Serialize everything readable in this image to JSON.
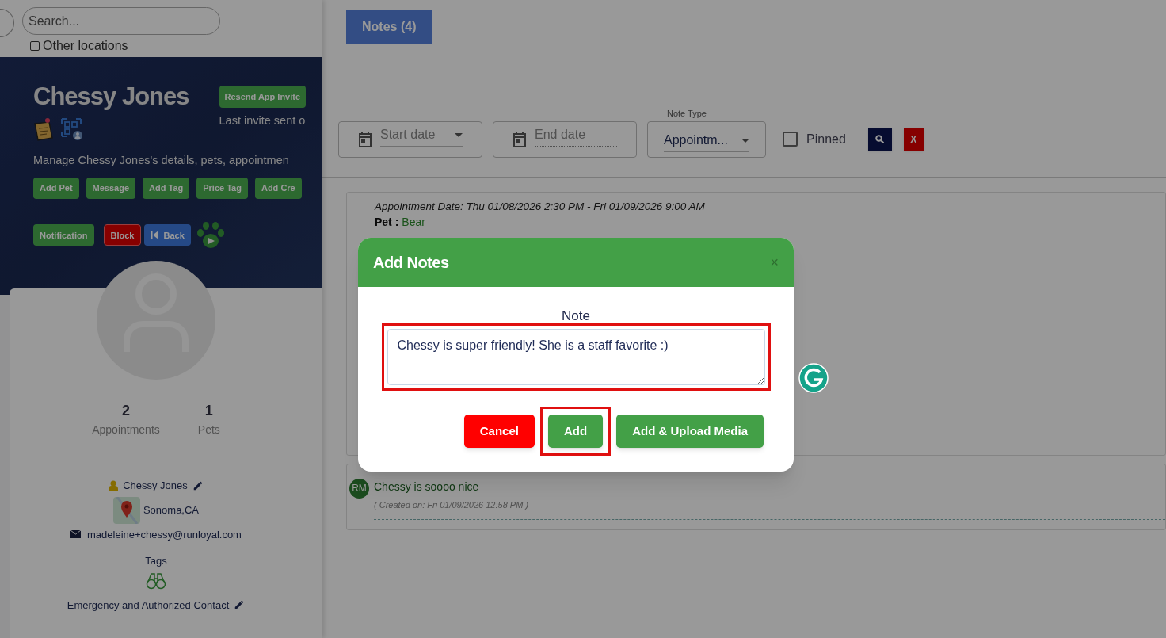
{
  "search": {
    "placeholder": "Search..."
  },
  "other_locations": {
    "label": "Other locations",
    "checked": false
  },
  "profile": {
    "name": "Chessy Jones",
    "resend_button": "Resend App Invite",
    "last_invite": "Last invite sent o",
    "description": "Manage Chessy Jones's details, pets, appointmen",
    "actions": [
      {
        "label": "Add Pet",
        "kind": "success"
      },
      {
        "label": "Message",
        "kind": "success"
      },
      {
        "label": "Add Tag",
        "kind": "success"
      },
      {
        "label": "Price Tag",
        "kind": "success"
      },
      {
        "label": "Add Cre",
        "kind": "success"
      }
    ],
    "actions_row2": [
      {
        "label": "Notification",
        "kind": "success"
      },
      {
        "label": "Block",
        "kind": "danger"
      },
      {
        "label": "Back",
        "kind": "primary"
      }
    ]
  },
  "stats": [
    {
      "value": "2",
      "label": "Appointments"
    },
    {
      "value": "1",
      "label": "Pets"
    }
  ],
  "contact": {
    "name": "Chessy Jones",
    "location": "Sonoma,CA",
    "email": "madeleine+chessy@runloyal.com",
    "tags_label": "Tags",
    "emergency": "Emergency and Authorized Contact"
  },
  "tabs": [
    {
      "label": "Notes (4)",
      "selected": true
    }
  ],
  "filters": {
    "start_date": {
      "placeholder": "Start date"
    },
    "end_date": {
      "placeholder": "End date"
    },
    "note_type": {
      "label": "Note Type",
      "value": "Appointm..."
    },
    "pinned": {
      "label": "Pinned",
      "checked": false
    },
    "clear_button": "X"
  },
  "appointment_note": {
    "date": "Appointment Date: Thu 01/08/2026 2:30 PM - Fri 01/09/2026 9:00 AM",
    "pet_label": "Pet :",
    "pet_name": "Bear"
  },
  "general_note": {
    "initials": "RM",
    "text": "Chessy is soooo nice",
    "created": "( Created on: Fri 01/09/2026 12:58 PM )"
  },
  "modal": {
    "title": "Add Notes",
    "close": "×",
    "field_label": "Note",
    "value": "Chessy is super friendly! She is a staff favorite :)",
    "field_highlighted": true,
    "buttons": [
      {
        "label": "Cancel",
        "kind": "danger",
        "highlighted": false
      },
      {
        "label": "Add",
        "kind": "success",
        "highlighted": true
      },
      {
        "label": "Add & Upload Media",
        "kind": "success",
        "highlighted": false
      }
    ]
  }
}
